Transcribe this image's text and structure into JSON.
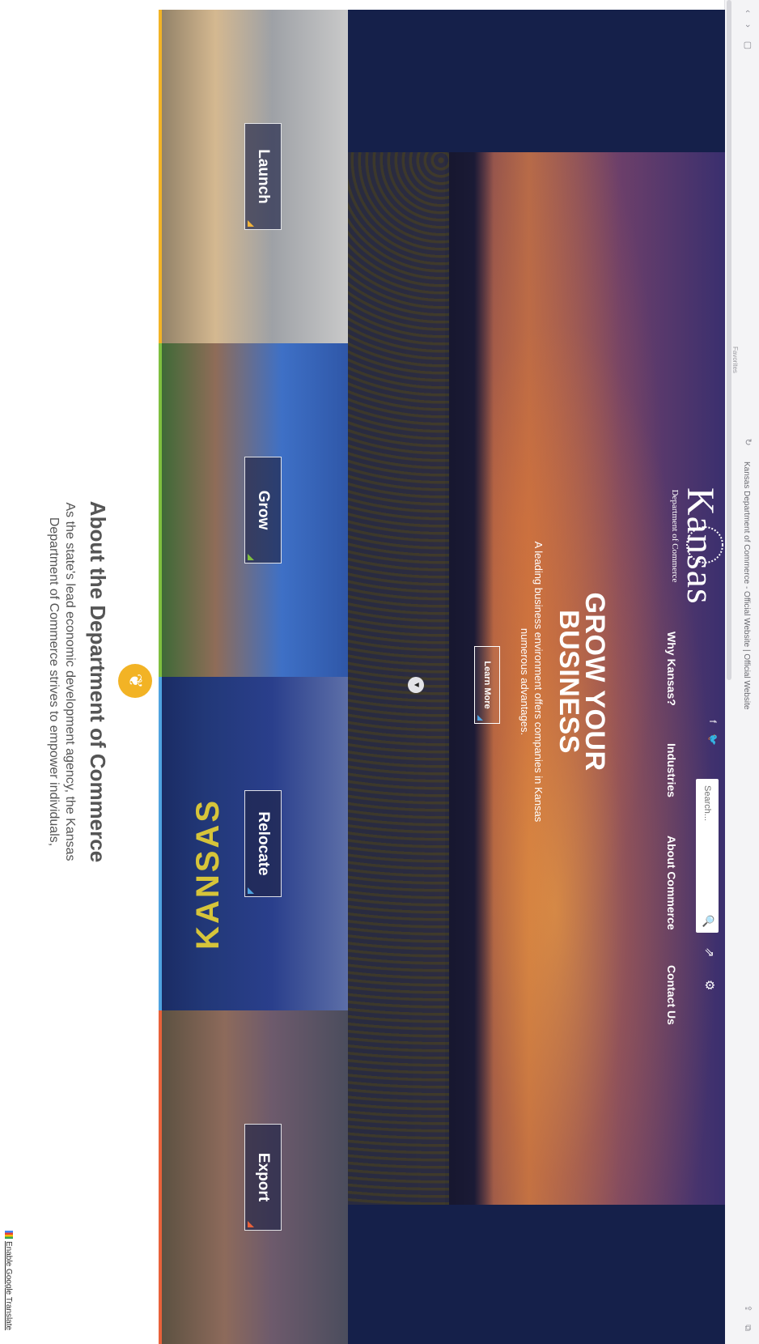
{
  "browser": {
    "tab_title": "Kansas Department of Commerce - Official Website | Official Website",
    "favorites_label": "Favorites"
  },
  "logo": {
    "word": "Kansas",
    "subtitle": "Department of Commerce"
  },
  "nav": {
    "items": [
      "Why Kansas?",
      "Industries",
      "About Commerce",
      "Contact Us"
    ]
  },
  "search": {
    "placeholder": "Search..."
  },
  "hero": {
    "headline": "GROW YOUR BUSINESS",
    "tagline": "A leading business environment offers companies in Kansas numerous advantages.",
    "cta": "Learn More"
  },
  "tiles": [
    {
      "label": "Launch",
      "color": "#f2b325"
    },
    {
      "label": "Grow",
      "color": "#7fbf3f"
    },
    {
      "label": "Relocate",
      "color": "#4fa3e0"
    },
    {
      "label": "Export",
      "color": "#e8613a"
    }
  ],
  "flag_text": "KANSAS",
  "about": {
    "title": "About the Department of Commerce",
    "body": "As the state's lead economic development agency, the Kansas Department of Commerce strives to empower individuals,"
  },
  "footer": {
    "translate_link": "Enable Google Translate"
  },
  "icons": [
    "facebook-icon",
    "twitter-icon",
    "search-icon",
    "share-icon",
    "settings-icon",
    "chevron-down-icon",
    "wheat-emblem-icon",
    "google-icon"
  ]
}
